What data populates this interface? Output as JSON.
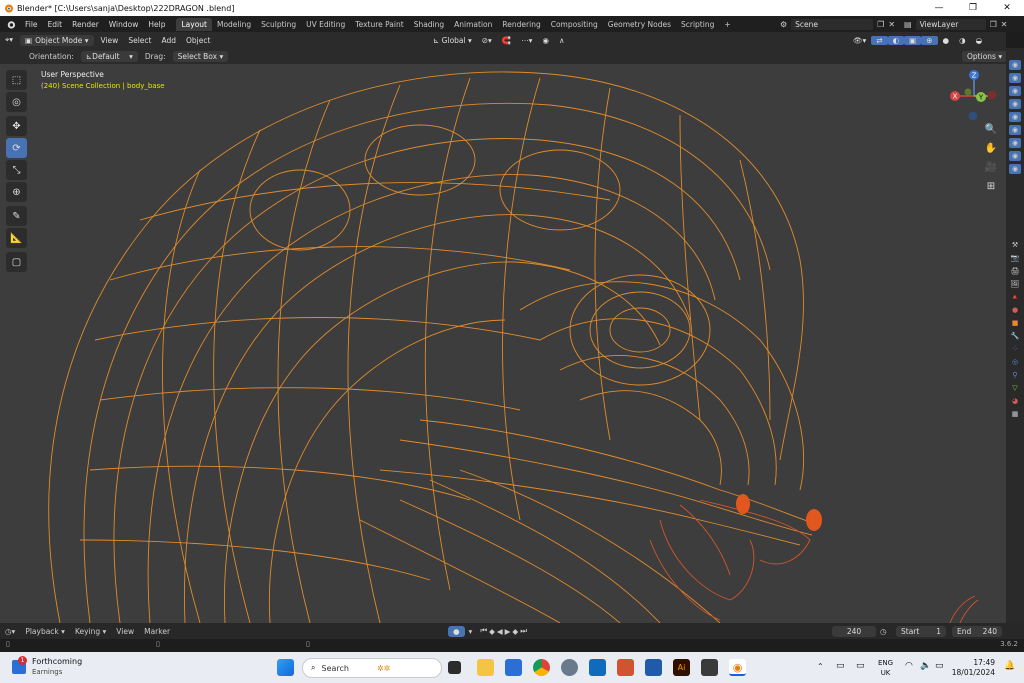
{
  "window": {
    "title": "Blender* [C:\\Users\\sanja\\Desktop\\222DRAGON .blend]"
  },
  "menu": [
    "File",
    "Edit",
    "Render",
    "Window",
    "Help"
  ],
  "workspaces": [
    "Layout",
    "Modeling",
    "Sculpting",
    "UV Editing",
    "Texture Paint",
    "Shading",
    "Animation",
    "Rendering",
    "Compositing",
    "Geometry Nodes",
    "Scripting"
  ],
  "scene": {
    "name": "Scene",
    "view_layer": "ViewLayer"
  },
  "header": {
    "mode": "Object Mode",
    "menus": [
      "View",
      "Select",
      "Add",
      "Object"
    ],
    "transform": "Global",
    "orientation_label": "Orientation:",
    "orientation_value": "Default",
    "drag_label": "Drag:",
    "drag_value": "Select Box",
    "options": "Options"
  },
  "viewport": {
    "perspective": "User Perspective",
    "collection": "(240) Scene Collection | body_base"
  },
  "gizmo": {
    "x": "X",
    "y": "Y",
    "z": "Z"
  },
  "timeline": {
    "menus": [
      "Playback",
      "Keying",
      "View",
      "Marker"
    ],
    "current_frame": "240",
    "start_label": "Start",
    "start_value": "1",
    "end_label": "End",
    "end_value": "240"
  },
  "version": "3.6.2",
  "taskbar": {
    "weather_title": "Forthcoming",
    "weather_sub": "Earnings",
    "badge": "1",
    "search": "Search",
    "lang1": "ENG",
    "lang2": "UK",
    "time": "17:49",
    "date": "18/01/2024"
  },
  "colors": {
    "wire": "#e8902c",
    "accent": "#4772b3",
    "viewport_bg": "#3d3d3d"
  }
}
